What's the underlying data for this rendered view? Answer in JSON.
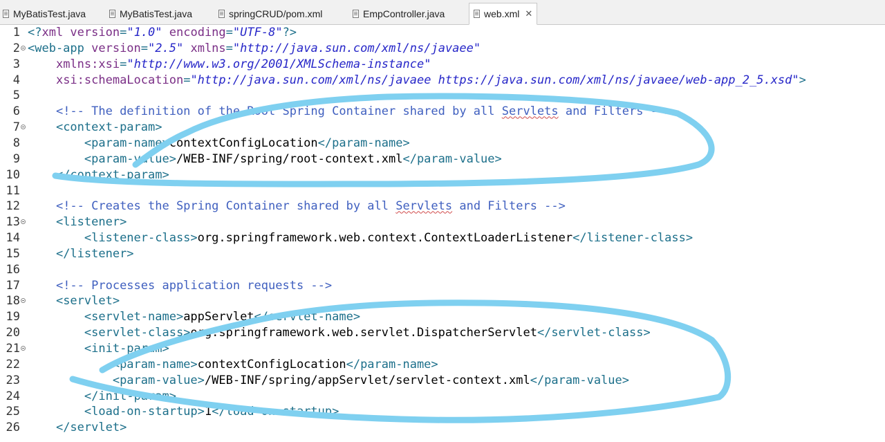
{
  "tabs": [
    {
      "label": "MyBatisTest.java",
      "icon": "java-file-icon"
    },
    {
      "label": "MyBatisTest.java",
      "icon": "java-file-icon"
    },
    {
      "label": "springCRUD/pom.xml",
      "icon": "xml-file-icon"
    },
    {
      "label": "EmpController.java",
      "icon": "java-file-icon"
    },
    {
      "label": "web.xml",
      "icon": "xml-file-icon",
      "active": true,
      "close": "✕"
    }
  ],
  "lines": [
    {
      "n": "1",
      "fold": false,
      "indent": 0,
      "tokens": [
        [
          "t",
          "<?"
        ],
        [
          "a",
          "xml version"
        ],
        [
          "t",
          "="
        ],
        [
          "s",
          "\"1.0\""
        ],
        [
          "t",
          " "
        ],
        [
          "a",
          "encoding"
        ],
        [
          "t",
          "="
        ],
        [
          "s",
          "\"UTF-8\""
        ],
        [
          "t",
          "?>"
        ]
      ]
    },
    {
      "n": "2",
      "fold": true,
      "indent": 0,
      "tokens": [
        [
          "t",
          "<web-app "
        ],
        [
          "a",
          "version"
        ],
        [
          "t",
          "="
        ],
        [
          "s",
          "\"2.5\""
        ],
        [
          "t",
          " "
        ],
        [
          "a",
          "xmlns"
        ],
        [
          "t",
          "="
        ],
        [
          "s",
          "\"http://java.sun.com/xml/ns/javaee\""
        ]
      ]
    },
    {
      "n": "3",
      "fold": false,
      "indent": 4,
      "tokens": [
        [
          "a",
          "xmlns:xsi"
        ],
        [
          "t",
          "="
        ],
        [
          "s",
          "\"http://www.w3.org/2001/XMLSchema-instance\""
        ]
      ]
    },
    {
      "n": "4",
      "fold": false,
      "indent": 4,
      "tokens": [
        [
          "a",
          "xsi:schemaLocation"
        ],
        [
          "t",
          "="
        ],
        [
          "s",
          "\"http://java.sun.com/xml/ns/javaee https://java.sun.com/xml/ns/javaee/web-app_2_5.xsd\""
        ],
        [
          "t",
          ">"
        ]
      ]
    },
    {
      "n": "5",
      "fold": false,
      "indent": 0,
      "tokens": []
    },
    {
      "n": "6",
      "fold": false,
      "indent": 4,
      "tokens": [
        [
          "c",
          "<!-- The definition of the Root Spring Container shared by all "
        ],
        [
          "sq",
          "Servlets"
        ],
        [
          "c",
          " and Filters -->"
        ]
      ]
    },
    {
      "n": "7",
      "fold": true,
      "indent": 4,
      "tokens": [
        [
          "t",
          "<context-param>"
        ]
      ]
    },
    {
      "n": "8",
      "fold": false,
      "indent": 8,
      "tokens": [
        [
          "t",
          "<param-name>"
        ],
        [
          "x",
          "contextConfigLocation"
        ],
        [
          "t",
          "</param-name>"
        ]
      ]
    },
    {
      "n": "9",
      "fold": false,
      "indent": 8,
      "tokens": [
        [
          "t",
          "<param-value>"
        ],
        [
          "x",
          "/WEB-INF/spring/root-context.xml"
        ],
        [
          "t",
          "</param-value>"
        ]
      ]
    },
    {
      "n": "10",
      "fold": false,
      "indent": 4,
      "tokens": [
        [
          "t",
          "</context-param>"
        ]
      ]
    },
    {
      "n": "11",
      "fold": false,
      "indent": 0,
      "tokens": []
    },
    {
      "n": "12",
      "fold": false,
      "indent": 4,
      "tokens": [
        [
          "c",
          "<!-- Creates the Spring Container shared by all "
        ],
        [
          "sq",
          "Servlets"
        ],
        [
          "c",
          " and Filters -->"
        ]
      ]
    },
    {
      "n": "13",
      "fold": true,
      "indent": 4,
      "tokens": [
        [
          "t",
          "<listener>"
        ]
      ]
    },
    {
      "n": "14",
      "fold": false,
      "indent": 8,
      "tokens": [
        [
          "t",
          "<listener-class>"
        ],
        [
          "x",
          "org.springframework.web.context.ContextLoaderListener"
        ],
        [
          "t",
          "</listener-class>"
        ]
      ]
    },
    {
      "n": "15",
      "fold": false,
      "indent": 4,
      "tokens": [
        [
          "t",
          "</listener>"
        ]
      ]
    },
    {
      "n": "16",
      "fold": false,
      "indent": 0,
      "tokens": []
    },
    {
      "n": "17",
      "fold": false,
      "indent": 4,
      "tokens": [
        [
          "c",
          "<!-- Processes application requests -->"
        ]
      ]
    },
    {
      "n": "18",
      "fold": true,
      "indent": 4,
      "tokens": [
        [
          "t",
          "<servlet>"
        ]
      ]
    },
    {
      "n": "19",
      "fold": false,
      "indent": 8,
      "tokens": [
        [
          "t",
          "<servlet-name>"
        ],
        [
          "x",
          "appServlet"
        ],
        [
          "t",
          "</servlet-name>"
        ]
      ]
    },
    {
      "n": "20",
      "fold": false,
      "indent": 8,
      "tokens": [
        [
          "t",
          "<servlet-class>"
        ],
        [
          "x",
          "org.springframework.web.servlet.DispatcherServlet"
        ],
        [
          "t",
          "</servlet-class>"
        ]
      ]
    },
    {
      "n": "21",
      "fold": true,
      "indent": 8,
      "tokens": [
        [
          "t",
          "<init-param>"
        ]
      ]
    },
    {
      "n": "22",
      "fold": false,
      "indent": 12,
      "tokens": [
        [
          "t",
          "<param-name>"
        ],
        [
          "x",
          "contextConfigLocation"
        ],
        [
          "t",
          "</param-name>"
        ]
      ]
    },
    {
      "n": "23",
      "fold": false,
      "indent": 12,
      "tokens": [
        [
          "t",
          "<param-value>"
        ],
        [
          "x",
          "/WEB-INF/spring/appServlet/servlet-context.xml"
        ],
        [
          "t",
          "</param-value>"
        ]
      ]
    },
    {
      "n": "24",
      "fold": false,
      "indent": 8,
      "tokens": [
        [
          "t",
          "</init-param>"
        ]
      ]
    },
    {
      "n": "25",
      "fold": false,
      "indent": 8,
      "tokens": [
        [
          "t",
          "<load-on-startup>"
        ],
        [
          "x",
          "1"
        ],
        [
          "t",
          "</load-on-startup>"
        ]
      ]
    },
    {
      "n": "26",
      "fold": false,
      "indent": 4,
      "tokens": [
        [
          "t",
          "</servlet>"
        ]
      ]
    }
  ],
  "colors": {
    "tag": "#1c6f8a",
    "attribute": "#7a2e86",
    "string": "#2626c8",
    "comment": "#3f5fbf",
    "annotation": "#7fd0f0"
  }
}
